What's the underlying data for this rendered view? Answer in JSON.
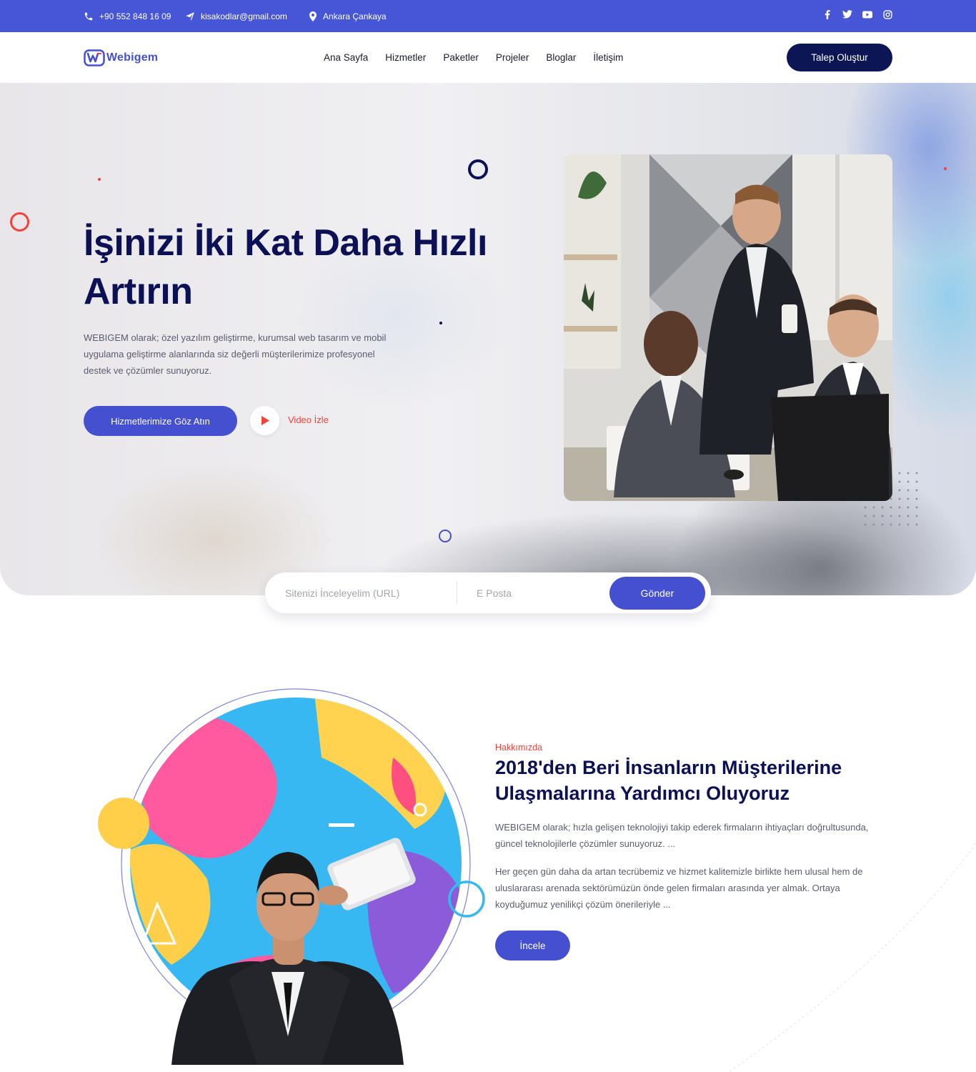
{
  "topbar": {
    "phone": "+90 552 848 16 09",
    "email": "kisakodlar@gmail.com",
    "location": "Ankara Çankaya",
    "socials": [
      "facebook-icon",
      "twitter-icon",
      "youtube-icon",
      "instagram-icon"
    ]
  },
  "header": {
    "logo_text": "Webigem",
    "nav": [
      "Ana Sayfa",
      "Hizmetler",
      "Paketler",
      "Projeler",
      "Bloglar",
      "İletişim"
    ],
    "cta_label": "Talep Oluştur"
  },
  "hero": {
    "title": "İşinizi İki Kat Daha Hızlı Artırın",
    "description": "WEBIGEM olarak; özel yazılım geliştirme, kurumsal web tasarım ve mobil uygulama geliştirme alanlarında siz değerli müşterilerimize profesyonel destek ve çözümler sunuyoruz.",
    "primary_button": "Hizmetlerimize Göz Atın",
    "video_label": "Video İzle"
  },
  "search": {
    "url_placeholder": "Sitenizi İnceleyelim (URL)",
    "url_value": "",
    "email_placeholder": "E Posta",
    "email_value": "",
    "submit_label": "Gönder"
  },
  "about": {
    "subtitle": "Hakkımızda",
    "title": "2018'den Beri İnsanların Müşterilerine Ulaşmalarına Yardımcı Oluyoruz",
    "paragraph1": "WEBIGEM olarak; hızla gelişen teknolojiyi takip ederek firmaların ihtiyaçları doğrultusunda, güncel teknolojilerle çözümler sunuyoruz. ...",
    "paragraph2": "Her geçen gün daha da artan tecrübemiz ve hizmet kalitemizle birlikte hem ulusal hem de uluslararası arenada sektörümüzün önde gelen firmaları arasında yer almak. Ortaya koyduğumuz yenilikçi çözüm önerileriyle ...",
    "button_label": "İncele"
  },
  "colors": {
    "topbar": "#4656d6",
    "primary": "#4450cf",
    "navy": "#0b1154",
    "accent_red": "#f2433a"
  }
}
